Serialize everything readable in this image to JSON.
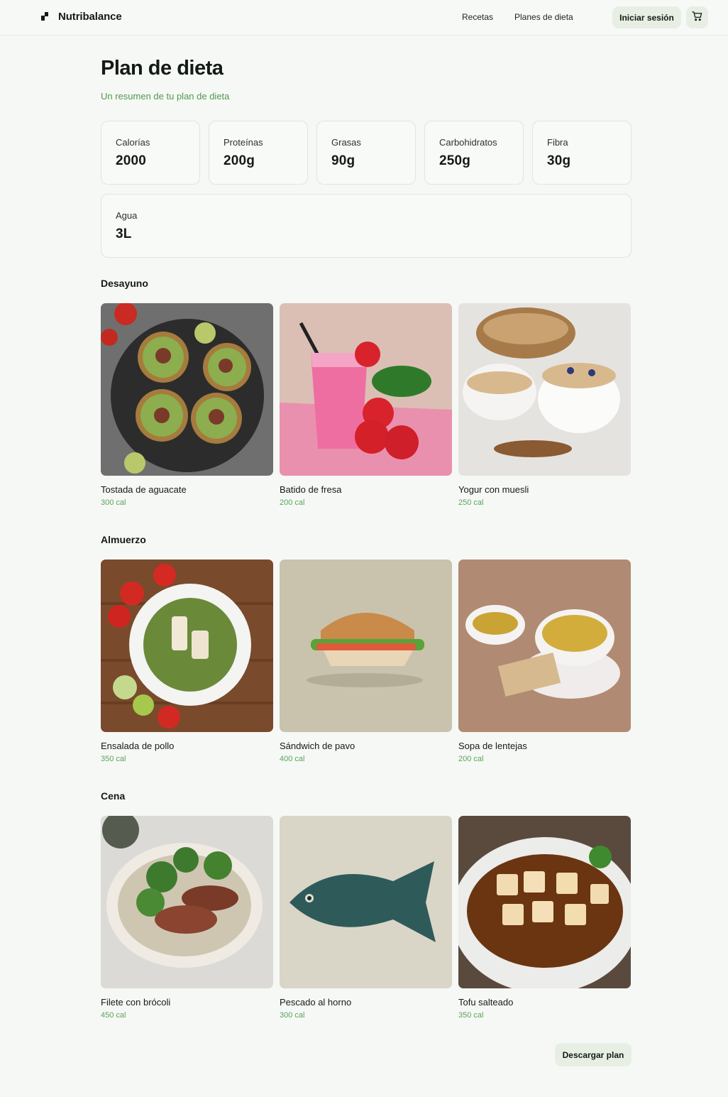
{
  "header": {
    "brand": "Nutribalance",
    "nav": [
      "Recetas",
      "Planes de dieta"
    ],
    "login_label": "Iniciar sesión"
  },
  "page": {
    "title": "Plan de dieta",
    "subtitle": "Un resumen de tu plan de dieta"
  },
  "stats": [
    {
      "label": "Calorías",
      "value": "2000"
    },
    {
      "label": "Proteínas",
      "value": "200g"
    },
    {
      "label": "Grasas",
      "value": "90g"
    },
    {
      "label": "Carbohidratos",
      "value": "250g"
    },
    {
      "label": "Fibra",
      "value": "30g"
    },
    {
      "label": "Agua",
      "value": "3L"
    }
  ],
  "sections": [
    {
      "title": "Desayuno",
      "meals": [
        {
          "name": "Tostada de aguacate",
          "calories": "300 cal",
          "icon": "avocado-toast-image"
        },
        {
          "name": "Batido de fresa",
          "calories": "200 cal",
          "icon": "strawberry-smoothie-image"
        },
        {
          "name": "Yogur con muesli",
          "calories": "250 cal",
          "icon": "yogurt-muesli-image"
        }
      ]
    },
    {
      "title": "Almuerzo",
      "meals": [
        {
          "name": "Ensalada de pollo",
          "calories": "350 cal",
          "icon": "chicken-salad-image"
        },
        {
          "name": "Sándwich de pavo",
          "calories": "400 cal",
          "icon": "turkey-sandwich-image"
        },
        {
          "name": "Sopa de lentejas",
          "calories": "200 cal",
          "icon": "lentil-soup-image"
        }
      ]
    },
    {
      "title": "Cena",
      "meals": [
        {
          "name": "Filete con brócoli",
          "calories": "450 cal",
          "icon": "steak-broccoli-image"
        },
        {
          "name": "Pescado al horno",
          "calories": "300 cal",
          "icon": "baked-fish-image"
        },
        {
          "name": "Tofu salteado",
          "calories": "350 cal",
          "icon": "stir-fried-tofu-image"
        }
      ]
    }
  ],
  "footer": {
    "download_label": "Descargar plan"
  },
  "colors": {
    "background": "#f6f8f5",
    "accent_green": "#4e9a4a",
    "button_bg": "#e7efe4",
    "text": "#141a14"
  }
}
